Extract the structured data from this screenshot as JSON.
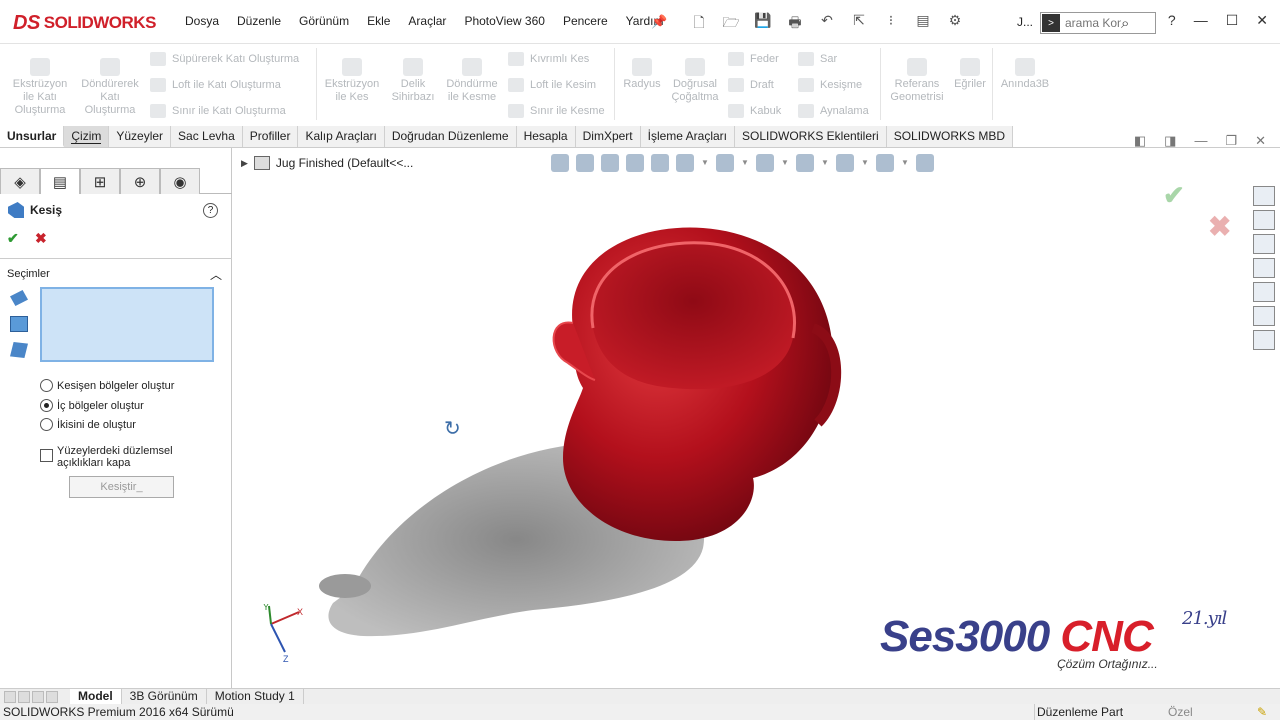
{
  "app": {
    "logo": "SOLIDWORKS",
    "logo_mark": "DS",
    "user": "J...",
    "brand_color": "#d0202a"
  },
  "menu": [
    "Dosya",
    "Düzenle",
    "Görünüm",
    "Ekle",
    "Araçlar",
    "PhotoView 360",
    "Pencere",
    "Yardım"
  ],
  "search": {
    "placeholder": "arama Kom"
  },
  "ribbon": {
    "big": [
      {
        "label": "Ekstrüzyon ile Katı Oluşturma"
      },
      {
        "label": "Döndürerek Katı Oluşturma"
      },
      {
        "label": "Ekstrüzyon ile Kes"
      },
      {
        "label": "Delik Sihirbazı"
      },
      {
        "label": "Döndürme ile Kesme"
      },
      {
        "label": "Radyus"
      },
      {
        "label": "Doğrusal Çoğaltma"
      },
      {
        "label": "Referans Geometrisi"
      },
      {
        "label": "Eğriler"
      },
      {
        "label": "Anında3B"
      }
    ],
    "small": [
      "Süpürerek Katı Oluşturma",
      "Loft ile Katı Oluşturma",
      "Sınır ile Katı Oluşturma",
      "Kıvrımlı Kes",
      "Loft ile Kesim",
      "Sınır ile Kesme",
      "Feder",
      "Draft",
      "Kabuk",
      "Sar",
      "Kesişme",
      "Aynalama"
    ]
  },
  "tabs": [
    "Unsurlar",
    "Çizim",
    "Yüzeyler",
    "Sac Levha",
    "Profiller",
    "Kalıp Araçları",
    "Doğrudan Düzenleme",
    "Hesapla",
    "DimXpert",
    "İşleme Araçları",
    "SOLIDWORKS Eklentileri",
    "SOLIDWORKS MBD"
  ],
  "panel": {
    "title": "Kesiş",
    "section": "Seçimler",
    "options": [
      "Kesişen bölgeler oluştur",
      "İç bölgeler oluştur",
      "İkisini de oluştur"
    ],
    "selected_option": 1,
    "checkbox": "Yüzeylerdeki düzlemsel açıklıkları kapa",
    "button": "Kesiştir_"
  },
  "viewport": {
    "tree_label": "Jug Finished  (Default<<...",
    "model_color": "#b3101c"
  },
  "watermark": {
    "part1": "Ses3000",
    "part2": "CNC",
    "year": "21.yıl",
    "slogan": "Çözüm Ortağınız..."
  },
  "bottom_tabs": [
    "Model",
    "3B Görünüm",
    "Motion Study 1"
  ],
  "status": {
    "left": "SOLIDWORKS Premium 2016 x64 Sürümü",
    "middle": "Düzenleme Part",
    "right": "Özel"
  },
  "axes": {
    "x": "X",
    "y": "Y",
    "z": "Z"
  }
}
